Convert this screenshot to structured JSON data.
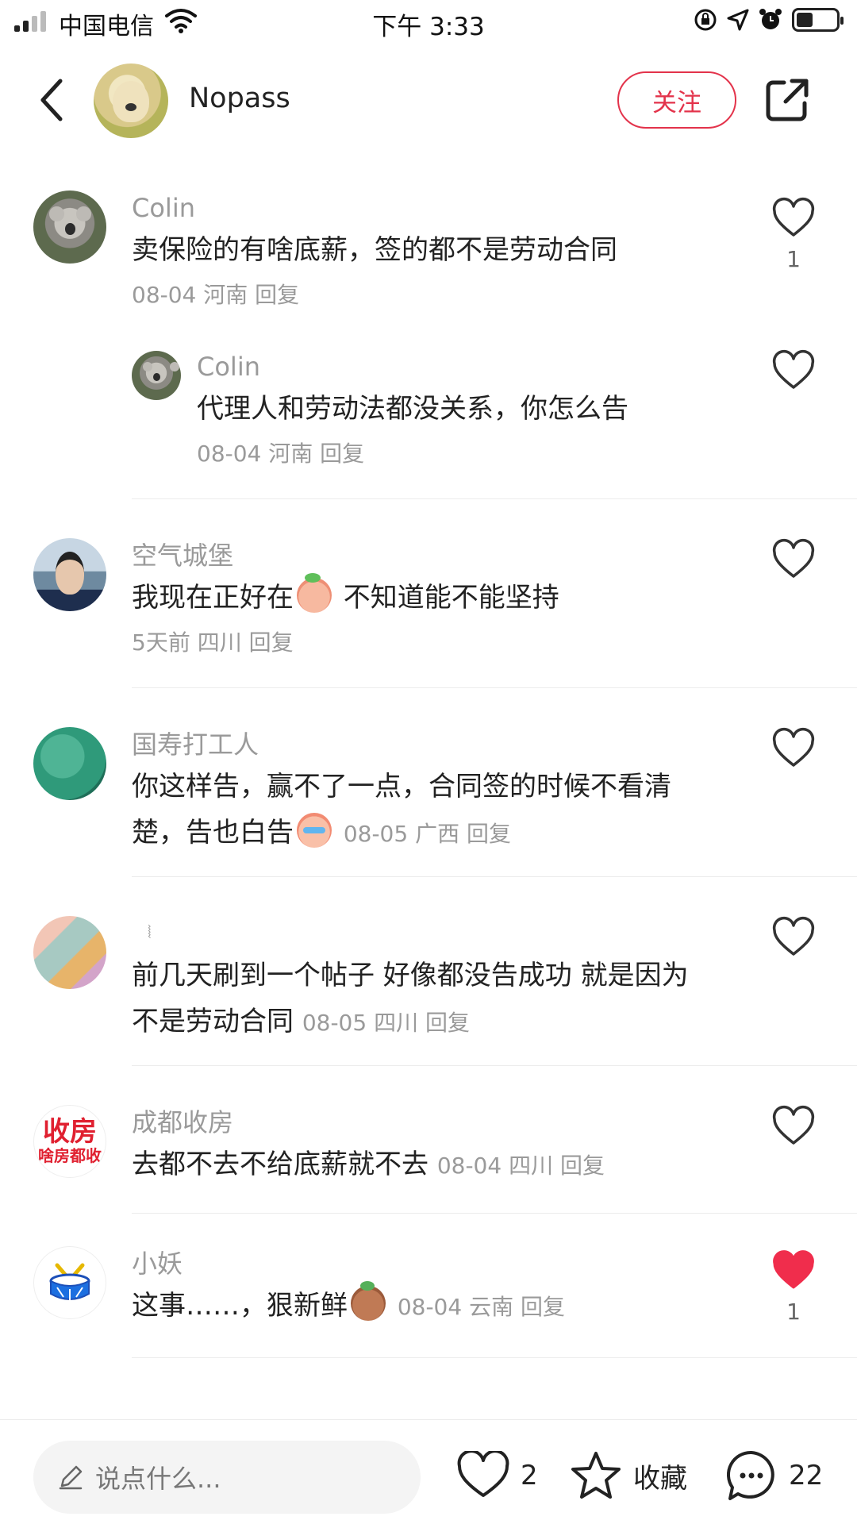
{
  "status_bar": {
    "carrier": "中国电信",
    "time": "下午 3:33"
  },
  "header": {
    "author_name": "Nopass",
    "follow_label": "关注"
  },
  "comments": [
    {
      "name": "Colin",
      "text": "卖保险的有啥底薪，签的都不是劳动合同",
      "meta": "08-04 河南 回复",
      "likes": "1"
    },
    {
      "name": "Colin",
      "text": "代理人和劳动法都没关系，你怎么告",
      "meta": "08-04 河南 回复"
    },
    {
      "name": "空气城堡",
      "text_before": "我现在正好在",
      "text_after": " 不知道能不能坚持",
      "meta": "5天前 四川 回复"
    },
    {
      "name": "国寿打工人",
      "text_line1": "你这样告，赢不了一点，合同签的时候不看清",
      "text_line2": "楚，告也白告",
      "meta": "08-05 广西 回复"
    },
    {
      "name": "⦚",
      "text_line1": "前几天刷到一个帖子 好像都没告成功 就是因为",
      "text_line2": "不是劳动合同",
      "meta": "08-05 四川 回复"
    },
    {
      "name": "成都收房",
      "text": "去都不去不给底薪就不去",
      "meta": "08-04 四川 回复",
      "avatar_line1": "收房",
      "avatar_line2": "啥房都收"
    },
    {
      "name": "小妖",
      "text": "这事……，狠新鲜",
      "meta": "08-04 云南 回复",
      "likes": "1",
      "liked": true
    }
  ],
  "bottom_bar": {
    "input_placeholder": "说点什么...",
    "like_count": "2",
    "collect_label": "收藏",
    "comment_count": "22"
  },
  "colors": {
    "accent": "#e3334b",
    "like_active": "#f02d4c",
    "muted_text": "#9a9a9a"
  },
  "icons": [
    "back-icon",
    "share-icon",
    "heart-icon",
    "star-icon",
    "comment-icon",
    "pencil-icon",
    "wifi-icon",
    "alarm-icon",
    "location-icon",
    "lock-rotation-icon"
  ]
}
